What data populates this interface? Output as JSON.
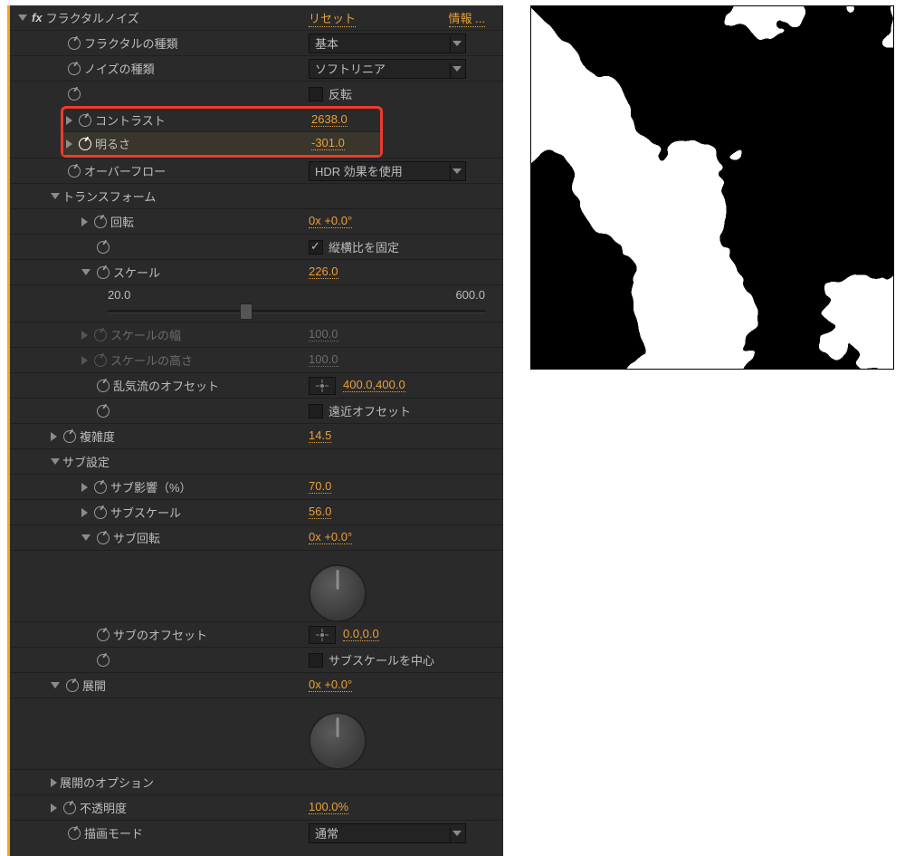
{
  "header": {
    "effect_name": "フラクタルノイズ",
    "reset": "リセット",
    "info": "情報 ..."
  },
  "rows": {
    "fractal_type": {
      "label": "フラクタルの種類",
      "value": "基本"
    },
    "noise_type": {
      "label": "ノイズの種類",
      "value": "ソフトリニア"
    },
    "invert": {
      "label": "反転"
    },
    "contrast": {
      "label": "コントラスト",
      "value": "2638.0"
    },
    "brightness": {
      "label": "明るさ",
      "value": "-301.0"
    },
    "overflow": {
      "label": "オーバーフロー",
      "value": "HDR 効果を使用"
    },
    "transform": {
      "label": "トランスフォーム"
    },
    "rotation": {
      "label": "回転",
      "value": "0x +0.0°"
    },
    "uniform_scale": {
      "label": "縦横比を固定"
    },
    "scale": {
      "label": "スケール",
      "value": "226.0"
    },
    "scale_min": "20.0",
    "scale_max": "600.0",
    "scale_w": {
      "label": "スケールの幅",
      "value": "100.0"
    },
    "scale_h": {
      "label": "スケールの高さ",
      "value": "100.0"
    },
    "turb_offset": {
      "label": "乱気流のオフセット",
      "value": "400.0,400.0"
    },
    "persp_offset": {
      "label": "遠近オフセット"
    },
    "complexity": {
      "label": "複雑度",
      "value": "14.5"
    },
    "sub": {
      "label": "サブ設定"
    },
    "sub_infl": {
      "label": "サブ影響（%）",
      "value": "70.0"
    },
    "sub_scale": {
      "label": "サブスケール",
      "value": "56.0"
    },
    "sub_rot": {
      "label": "サブ回転",
      "value": "0x +0.0°"
    },
    "sub_offset": {
      "label": "サブのオフセット",
      "value": "0.0,0.0"
    },
    "sub_center": {
      "label": "サブスケールを中心"
    },
    "evolution": {
      "label": "展開",
      "value": "0x +0.0°"
    },
    "evo_options": {
      "label": "展開のオプション"
    },
    "opacity": {
      "label": "不透明度",
      "value": "100.0%"
    },
    "blend": {
      "label": "描画モード",
      "value": "通常"
    }
  }
}
